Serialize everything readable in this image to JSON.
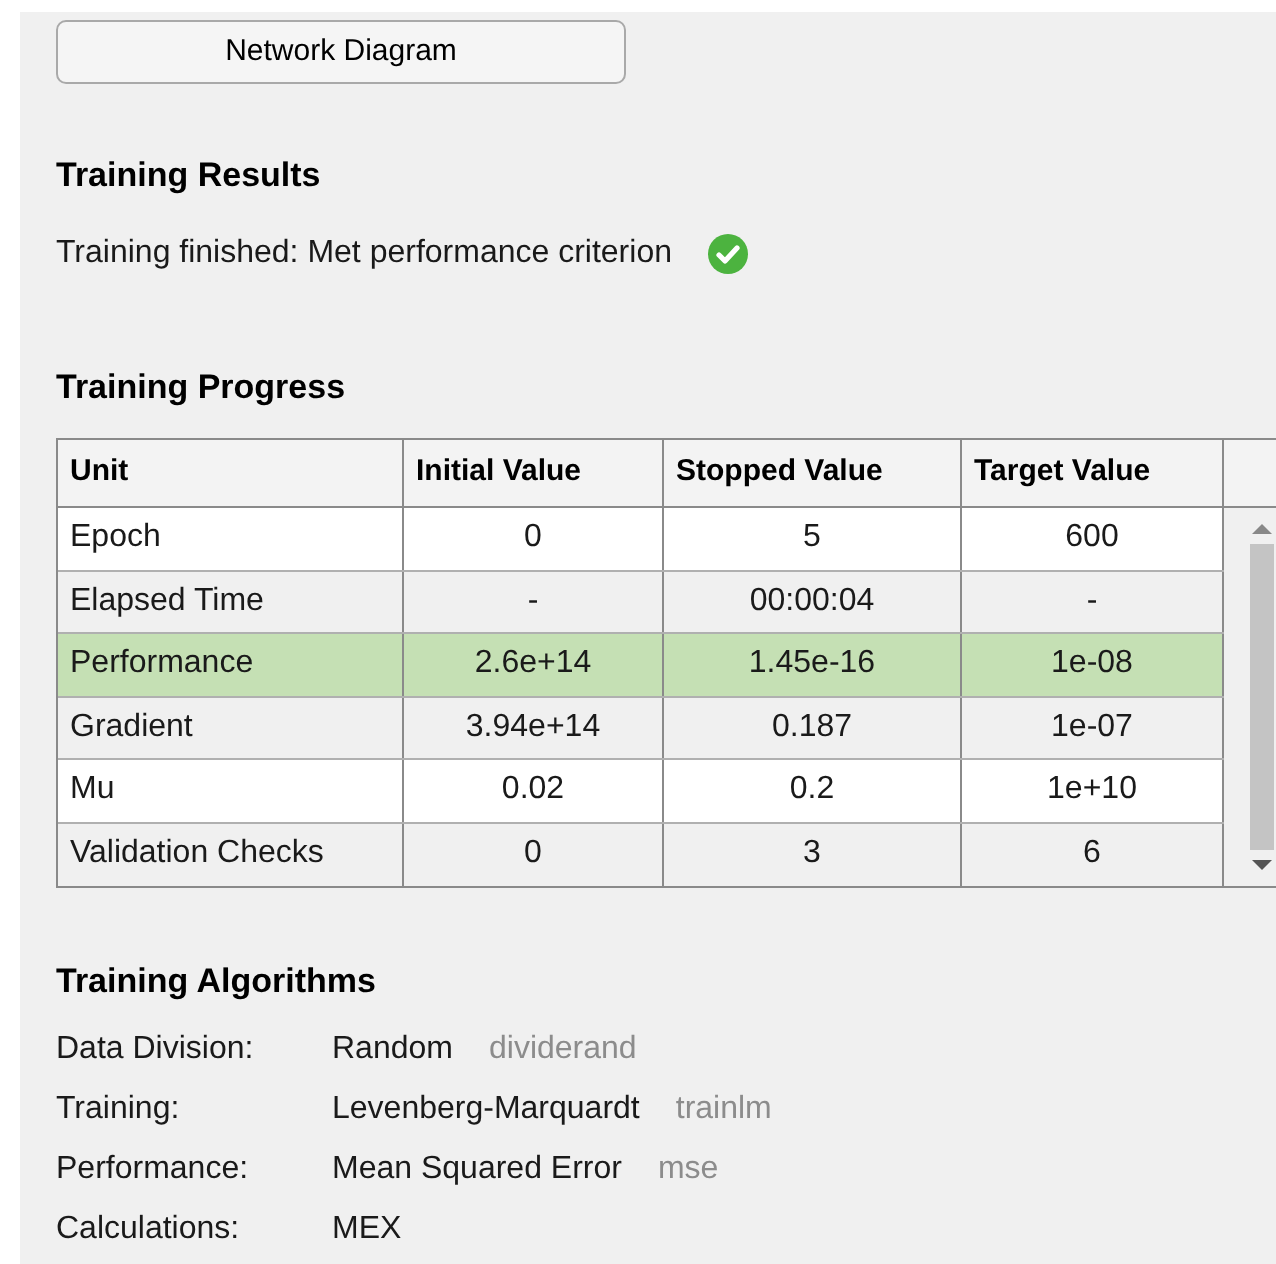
{
  "network_diagram_button": {
    "label": "Network Diagram"
  },
  "training_results": {
    "title": "Training Results",
    "status": "Training finished: Met performance criterion",
    "succeeded": true
  },
  "training_progress": {
    "title": "Training Progress",
    "table": {
      "columns": [
        "Unit",
        "Initial Value",
        "Stopped Value",
        "Target Value"
      ],
      "rows": [
        {
          "cells": [
            "Epoch",
            "0",
            "5",
            "600"
          ],
          "highlighted": false
        },
        {
          "cells": [
            "Elapsed Time",
            "-",
            "00:00:04",
            "-"
          ],
          "highlighted": false
        },
        {
          "cells": [
            "Performance",
            "2.6e+14",
            "1.45e-16",
            "1e-08"
          ],
          "highlighted": true
        },
        {
          "cells": [
            "Gradient",
            "3.94e+14",
            "0.187",
            "1e-07"
          ],
          "highlighted": false
        },
        {
          "cells": [
            "Mu",
            "0.02",
            "0.2",
            "1e+10"
          ],
          "highlighted": false
        },
        {
          "cells": [
            "Validation Checks",
            "0",
            "3",
            "6"
          ],
          "highlighted": false
        }
      ]
    }
  },
  "training_algorithms": {
    "title": "Training Algorithms",
    "items": [
      {
        "label": "Data Division:",
        "value": "Random",
        "function": "dividerand"
      },
      {
        "label": "Training:",
        "value": "Levenberg-Marquardt",
        "function": "trainlm"
      },
      {
        "label": "Performance:",
        "value": "Mean Squared Error",
        "function": "mse"
      },
      {
        "label": "Calculations:",
        "value": "MEX"
      }
    ]
  }
}
